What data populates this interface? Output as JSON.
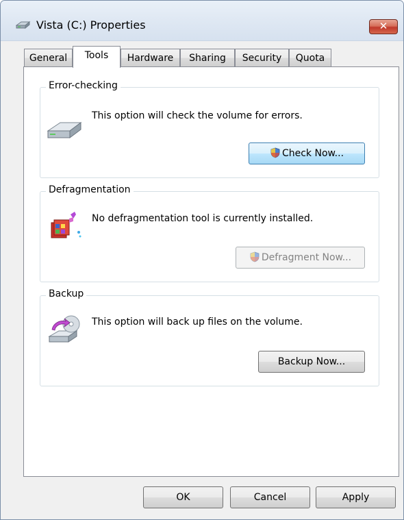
{
  "window": {
    "title": "Vista (C:) Properties",
    "close_glyph": "✕"
  },
  "tabs": [
    {
      "label": "General",
      "active": false
    },
    {
      "label": "Tools",
      "active": true
    },
    {
      "label": "Hardware",
      "active": false
    },
    {
      "label": "Sharing",
      "active": false
    },
    {
      "label": "Security",
      "active": false
    },
    {
      "label": "Quota",
      "active": false
    }
  ],
  "error_checking": {
    "legend": "Error-checking",
    "description": "This option will check the volume for errors.",
    "button_label": "Check Now...",
    "icon": "hard-drive-icon"
  },
  "defragmentation": {
    "legend": "Defragmentation",
    "description": "No defragmentation tool is currently installed.",
    "button_label": "Defragment Now...",
    "button_enabled": false,
    "icon": "defrag-icon"
  },
  "backup": {
    "legend": "Backup",
    "description": "This option will back up files on the volume.",
    "button_label": "Backup Now...",
    "icon": "backup-icon"
  },
  "footer": {
    "ok_label": "OK",
    "cancel_label": "Cancel",
    "apply_label": "Apply"
  },
  "colors": {
    "title_bar": "#dfe8f3",
    "close_button": "#c0392b",
    "focused_button": "#bee6fd"
  }
}
